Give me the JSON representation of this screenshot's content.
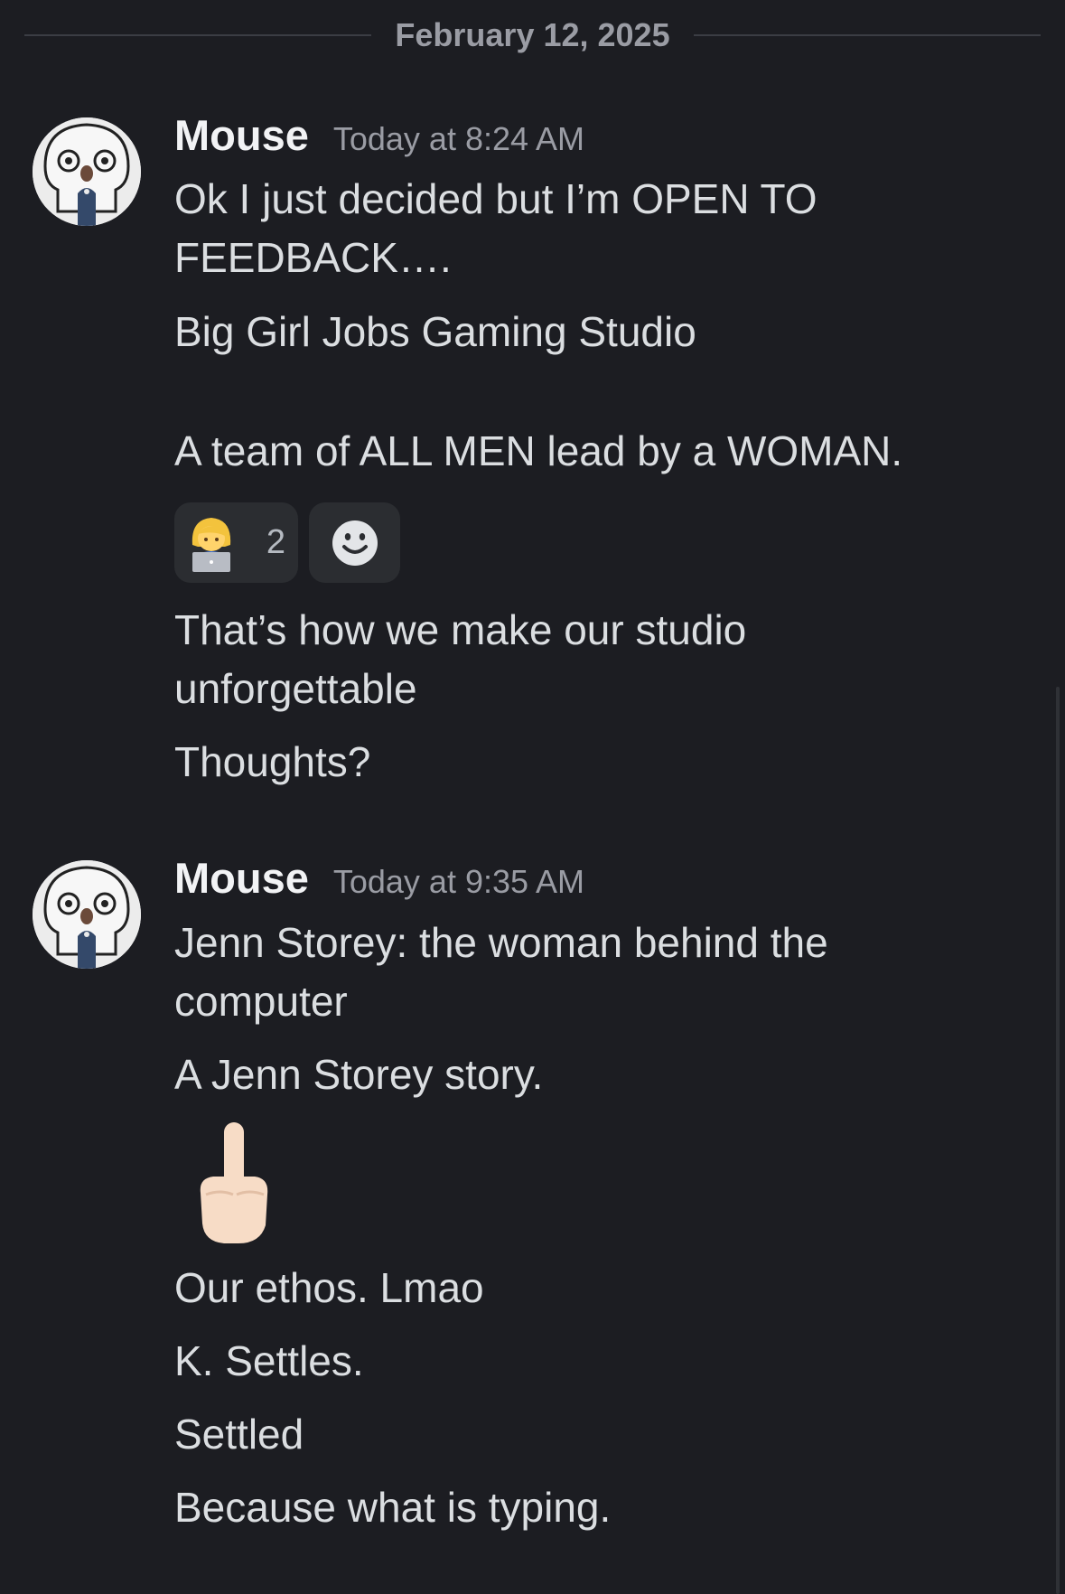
{
  "date_divider": "February 12, 2025",
  "messages": [
    {
      "username": "Mouse",
      "timestamp": "Today at 8:24 AM",
      "lines": [
        "Ok I just decided but I’m OPEN TO",
        "FEEDBACK….",
        "Big Girl Jobs Gaming Studio",
        "A team of ALL MEN lead by a WOMAN.",
        "That’s how we make our studio",
        "unforgettable",
        "Thoughts?"
      ],
      "reactions": [
        {
          "emoji_icon": "woman-technologist-emoji",
          "count": "2"
        }
      ],
      "add_reaction_icon": "smiley-face-icon"
    },
    {
      "username": "Mouse",
      "timestamp": "Today at 9:35 AM",
      "lines": [
        "Jenn Storey: the woman behind the",
        "computer",
        "A Jenn Storey story.",
        "Our ethos. Lmao",
        "K. Settles.",
        "Settled",
        "Because what is typing."
      ],
      "big_emoji_icon": "middle-finger-emoji"
    }
  ],
  "colors": {
    "background": "#1c1d22",
    "text": "#dbdee1",
    "muted": "#9a9ca4",
    "reaction_bg": "#2b2d31"
  }
}
